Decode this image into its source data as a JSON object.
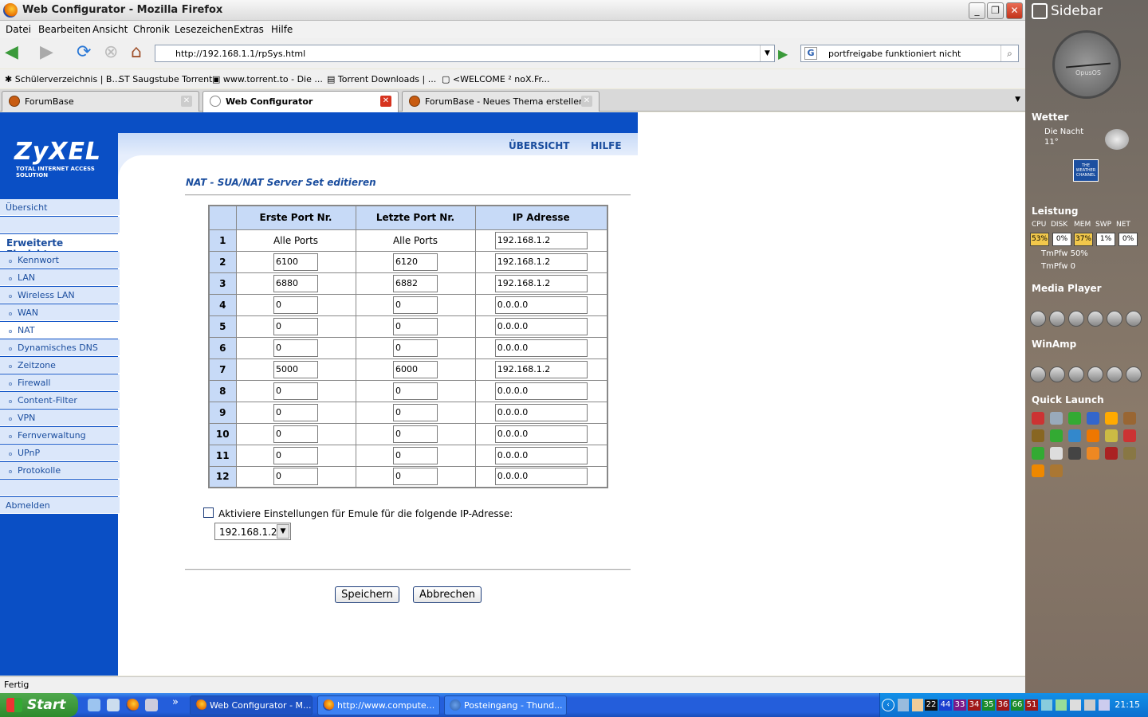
{
  "window": {
    "title": "Web Configurator - Mozilla Firefox"
  },
  "menu": [
    "Datei",
    "Bearbeiten",
    "Ansicht",
    "Chronik",
    "Lesezeichen",
    "Extras",
    "Hilfe"
  ],
  "nav": {
    "url": "http://192.168.1.1/rpSys.html",
    "search": "portfreigabe funktioniert nicht"
  },
  "bookmarks": [
    "Schülerverzeichnis | B...",
    "Saugstube Torrent",
    "www.torrent.to - Die ...",
    "Torrent Downloads | ...",
    "<WELCOME ² noX.Fr..."
  ],
  "tabs": [
    "ForumBase",
    "Web Configurator",
    "ForumBase - Neues Thema erstellen"
  ],
  "zyxel": {
    "logo": "ZyXEL",
    "tagline": "TOTAL INTERNET ACCESS SOLUTION",
    "top_links": [
      "ÜBERSICHT",
      "HILFE"
    ],
    "nav_overview": "Übersicht",
    "nav_header": "Erweiterte Einrichtung",
    "nav_items": [
      "Kennwort",
      "LAN",
      "Wireless LAN",
      "WAN",
      "NAT",
      "Dynamisches DNS",
      "Zeitzone",
      "Firewall",
      "Content-Filter",
      "VPN",
      "Fernverwaltung",
      "UPnP",
      "Protokolle"
    ],
    "nav_logout": "Abmelden",
    "page_title": "NAT - SUA/NAT Server Set editieren",
    "columns": [
      "Erste Port Nr.",
      "Letzte Port Nr.",
      "IP Adresse"
    ],
    "rows": [
      {
        "n": "1",
        "start": "Alle Ports",
        "end": "Alle Ports",
        "ip": "192.168.1.2"
      },
      {
        "n": "2",
        "start": "6100",
        "end": "6120",
        "ip": "192.168.1.2"
      },
      {
        "n": "3",
        "start": "6880",
        "end": "6882",
        "ip": "192.168.1.2"
      },
      {
        "n": "4",
        "start": "0",
        "end": "0",
        "ip": "0.0.0.0"
      },
      {
        "n": "5",
        "start": "0",
        "end": "0",
        "ip": "0.0.0.0"
      },
      {
        "n": "6",
        "start": "0",
        "end": "0",
        "ip": "0.0.0.0"
      },
      {
        "n": "7",
        "start": "5000",
        "end": "6000",
        "ip": "192.168.1.2"
      },
      {
        "n": "8",
        "start": "0",
        "end": "0",
        "ip": "0.0.0.0"
      },
      {
        "n": "9",
        "start": "0",
        "end": "0",
        "ip": "0.0.0.0"
      },
      {
        "n": "10",
        "start": "0",
        "end": "0",
        "ip": "0.0.0.0"
      },
      {
        "n": "11",
        "start": "0",
        "end": "0",
        "ip": "0.0.0.0"
      },
      {
        "n": "12",
        "start": "0",
        "end": "0",
        "ip": "0.0.0.0"
      }
    ],
    "emule_label": "Aktiviere Einstellungen für Emule für die folgende IP-Adresse:",
    "emule_ip": "192.168.1.2",
    "save": "Speichern",
    "cancel": "Abbrechen"
  },
  "status": "Fertig",
  "taskbar": {
    "start": "Start",
    "items": [
      "Web Configurator - M...",
      "http://www.compute...",
      "Posteingang - Thund..."
    ],
    "tray_numbers": [
      "22",
      "44",
      "33",
      "34",
      "35",
      "36",
      "66",
      "51"
    ],
    "clock": "21:15"
  },
  "vista_sidebar": {
    "title": "Sidebar",
    "clock_label": "OpusOS",
    "weather": {
      "title": "Wetter",
      "desc": "Die Nacht",
      "temp": "11°",
      "brand": "THE WEATHER CHANNEL"
    },
    "perf": {
      "title": "Leistung",
      "labels": [
        "CPU",
        "DISK",
        "MEM",
        "SWP",
        "NET"
      ],
      "values": [
        "53%",
        "0%",
        "37%",
        "1%",
        "0%"
      ],
      "lines": [
        "TmPfw 50%",
        "TmPfw 0"
      ]
    },
    "media": "Media Player",
    "winamp": "WinAmp",
    "quick": "Quick Launch"
  }
}
